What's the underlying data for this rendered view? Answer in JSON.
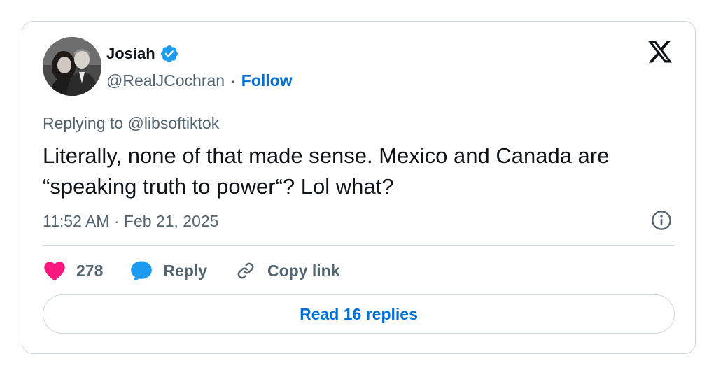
{
  "author": {
    "display_name": "Josiah",
    "handle": "@RealJCochran",
    "separator": "·",
    "follow_label": "Follow"
  },
  "tweet": {
    "replying_prefix": "Replying to ",
    "replying_to": "@libsoftiktok",
    "text": "Literally, none of that made sense. Mexico and Canada are “speaking truth to power“? Lol what?",
    "timestamp": "11:52 AM · Feb 21, 2025"
  },
  "actions": {
    "like_count": "278",
    "reply_label": "Reply",
    "copy_link_label": "Copy link"
  },
  "footer": {
    "read_replies_label": "Read 16 replies"
  },
  "colors": {
    "verified": "#1d9bf0",
    "like": "#f91880",
    "reply_icon": "#1d9bf0",
    "link": "#006fd6",
    "muted": "#536471",
    "border": "#cfd9de"
  },
  "icons": [
    "verified-badge-icon",
    "x-logo-icon",
    "info-icon",
    "heart-icon",
    "reply-bubble-icon",
    "link-icon"
  ]
}
